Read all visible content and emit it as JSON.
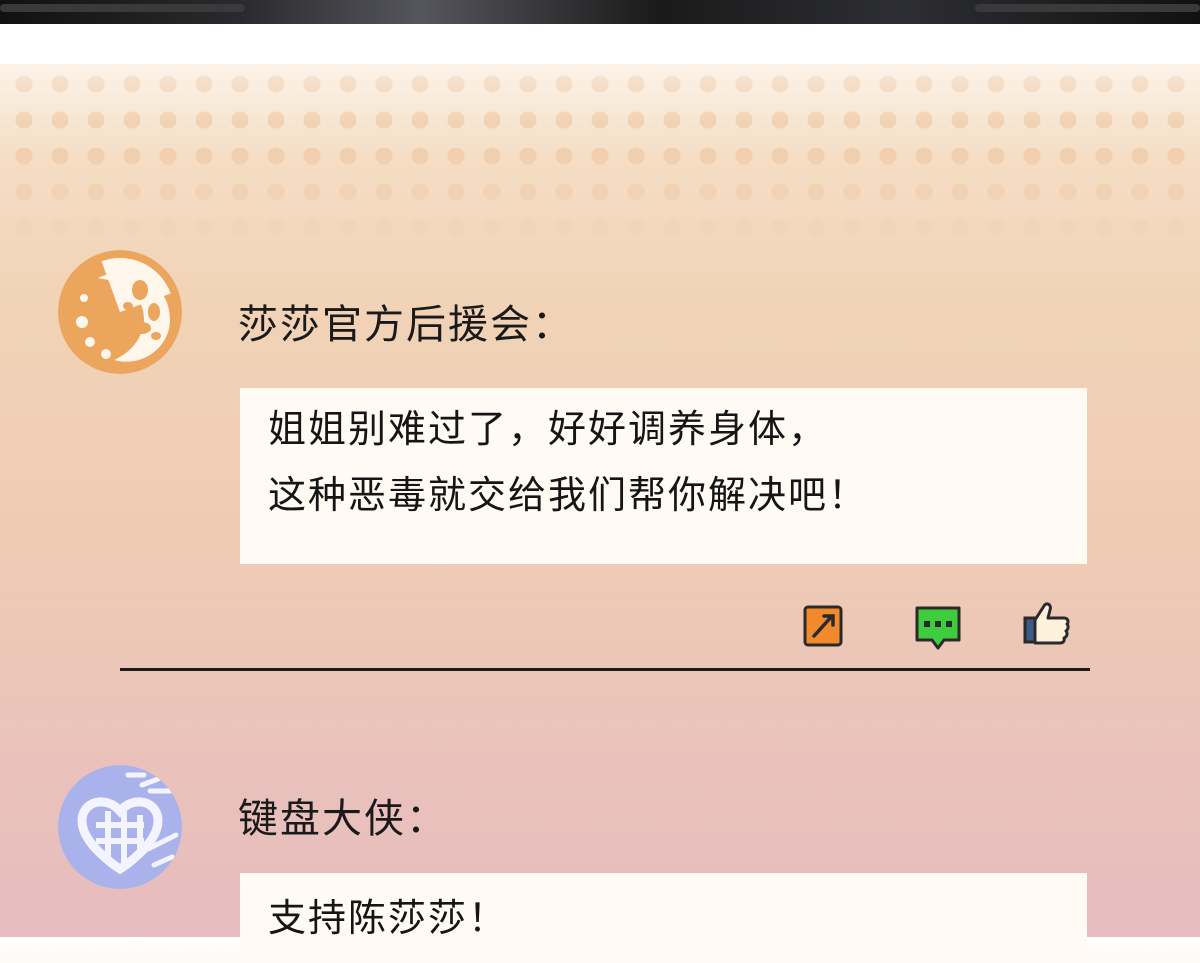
{
  "posts": [
    {
      "username": "莎莎官方后援会：",
      "lines": [
        "姐姐别难过了，好好调养身体，",
        "这种恶毒就交给我们帮你解决吧！"
      ],
      "avatar_color": "#eca55c"
    },
    {
      "username": "键盘大侠：",
      "lines": [
        "支持陈莎莎！"
      ],
      "avatar_color": "#a9b2ea"
    }
  ],
  "actions": [
    {
      "icon": "share-icon",
      "color": "#f08a2c"
    },
    {
      "icon": "comment-icon",
      "color": "#3fcc3f"
    },
    {
      "icon": "thumbs-up-icon",
      "color": "#3d5a8a"
    }
  ]
}
